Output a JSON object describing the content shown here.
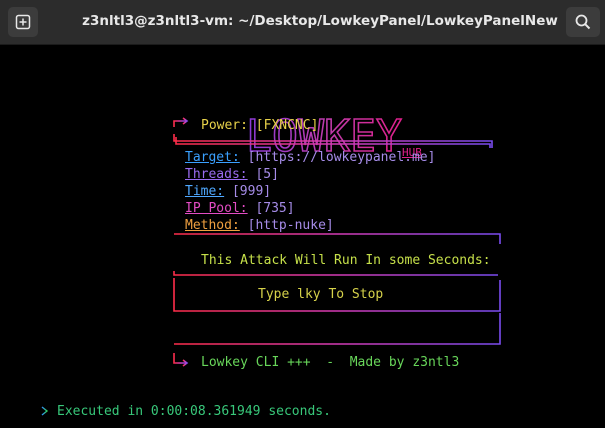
{
  "window": {
    "title": "z3nltl3@z3nltl3-vm: ~/Desktop/LowkeyPanel/LowkeyPanelNew",
    "new_tab_icon": "new-tab-icon",
    "search_icon": "search-icon"
  },
  "banner": {
    "logo_text": "LOWKEY",
    "hub_text": "HUB",
    "colors": {
      "logo_start": "#8a3bd6",
      "logo_end": "#e0208c"
    }
  },
  "panel": {
    "power_label": "Power:",
    "power_value": "[FXNCNC]",
    "fields": [
      {
        "label": "Target:",
        "value": "[https://lowkeypanel.me]",
        "color": "#3aa0ff"
      },
      {
        "label": "Threads:",
        "value": "[5]",
        "color": "#9b6cf0"
      },
      {
        "label": "Time:",
        "value": "[999]",
        "color": "#4fa8ff"
      },
      {
        "label": "IP Pool:",
        "value": "[735]",
        "color": "#e34cc4"
      },
      {
        "label": "Method:",
        "value": "[http-nuke]",
        "color": "#f0a040"
      }
    ],
    "notice": "This Attack Will Run In some Seconds:",
    "stop_hint": "Type lky To Stop",
    "footer": "Lowkey CLI +++  -  Made by z3ntl3"
  },
  "status": {
    "executed": "Executed in 0:00:08.361949 seconds."
  }
}
